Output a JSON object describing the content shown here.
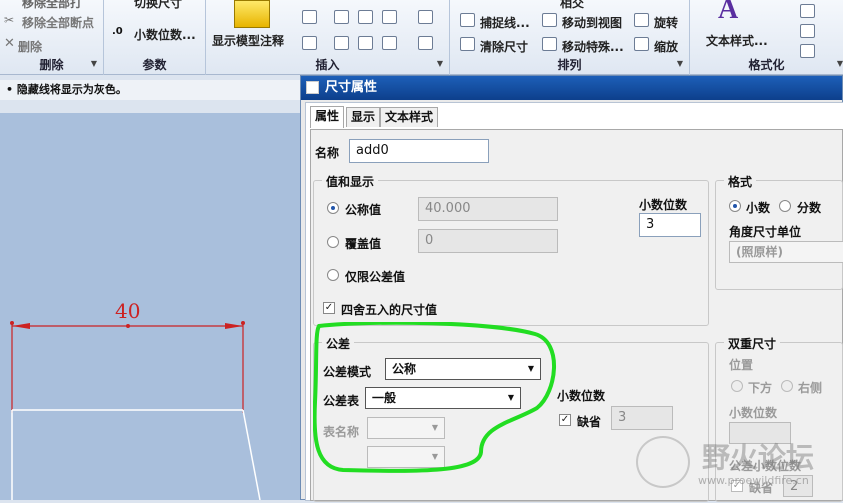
{
  "ribbon": {
    "delete_group": {
      "label": "删除",
      "items": [
        "移除全部断点",
        "删除"
      ],
      "top_partial": "移除全部打"
    },
    "params_group": {
      "label": "参数",
      "items": [
        "小数位数..."
      ],
      "top_partial": "切换尺寸"
    },
    "insert_group": {
      "label": "插入",
      "big_button": "显示模型注释"
    },
    "arrange_group": {
      "label": "排列",
      "items": [
        "捕捉线...",
        "清除尺寸",
        "移动到视图",
        "移动特殊...",
        "旋转",
        "缩放"
      ],
      "top_partial": "相交"
    },
    "format_group": {
      "label": "格式化",
      "big_button": "文本样式..."
    }
  },
  "status": {
    "text": "隐藏线将显示为灰色。"
  },
  "canvas": {
    "dimension_value": "40"
  },
  "dialog": {
    "title": "尺寸属性",
    "tabs": [
      "属性",
      "显示",
      "文本样式"
    ],
    "name_label": "名称",
    "name_value": "add0",
    "value_display": {
      "title": "值和显示",
      "nominal_label": "公称值",
      "nominal_value": "40.000",
      "override_label": "覆盖值",
      "override_value": "0",
      "tolerance_only_label": "仅限公差值",
      "round_label": "四舍五入的尺寸值",
      "decimals_label": "小数位数",
      "decimals_value": "3"
    },
    "format": {
      "title": "格式",
      "decimal_label": "小数",
      "fraction_label": "分数",
      "angle_unit_label": "角度尺寸单位",
      "angle_unit_value": "(照原样)"
    },
    "tolerance": {
      "title": "公差",
      "mode_label": "公差模式",
      "mode_value": "公称",
      "table_label": "公差表",
      "table_value": "一般",
      "table_name_label": "表名称",
      "decimals_label": "小数位数",
      "default_label": "缺省",
      "decimals_value": "3"
    },
    "dual": {
      "title": "双重尺寸",
      "position_label": "位置",
      "below_label": "下方",
      "right_label": "右侧",
      "decimals_label": "小数位数",
      "tol_decimals_label": "公差小数位数",
      "default_label": "缺省",
      "value": "2"
    }
  },
  "watermark": {
    "text": "野火论坛",
    "url": "www.proewildfire.cn"
  }
}
